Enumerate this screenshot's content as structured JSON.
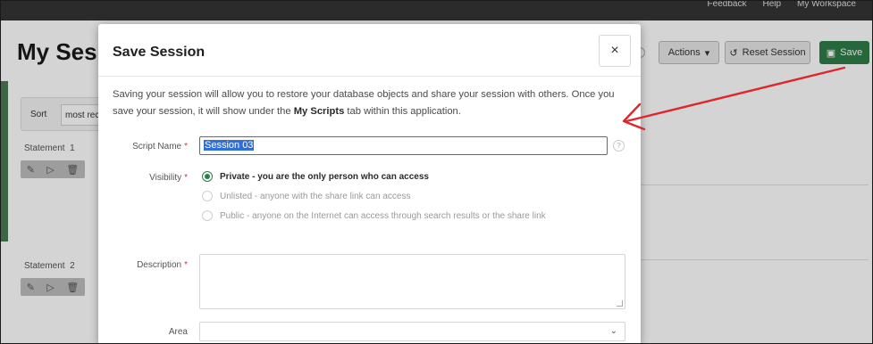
{
  "topbar": {
    "links": [
      "Feedback",
      "Help",
      "My Workspace"
    ]
  },
  "background": {
    "page_title": "My Ses",
    "toolbar": {
      "actions_label": "Actions",
      "reset_label": "Reset Session",
      "save_label": "Save"
    },
    "sort": {
      "label": "Sort",
      "value": "most rec"
    },
    "statements": [
      {
        "label": "Statement",
        "number": "1"
      },
      {
        "label": "Statement",
        "number": "2"
      }
    ]
  },
  "modal": {
    "title": "Save Session",
    "close_glyph": "×",
    "intro_before": "Saving your session will allow you to restore your database objects and share your session with others. Once you save your session, it will show under the ",
    "intro_bold": "My Scripts",
    "intro_after": " tab within this application.",
    "script_name_label": "Script Name",
    "script_name_value": "Session 03",
    "visibility_label": "Visibility",
    "visibility_options": [
      {
        "label": "Private - you are the only person who can access",
        "selected": true
      },
      {
        "label": "Unlisted - anyone with the share link can access",
        "selected": false
      },
      {
        "label": "Public - anyone on the Internet can access through search results or the share link",
        "selected": false
      }
    ],
    "description_label": "Description",
    "description_value": "",
    "area_label": "Area",
    "area_value": "",
    "required_marker": "*"
  },
  "colors": {
    "accent_green": "#2e7d47",
    "selection_blue": "#2f6fd6",
    "annotation_red": "#e0262b"
  }
}
